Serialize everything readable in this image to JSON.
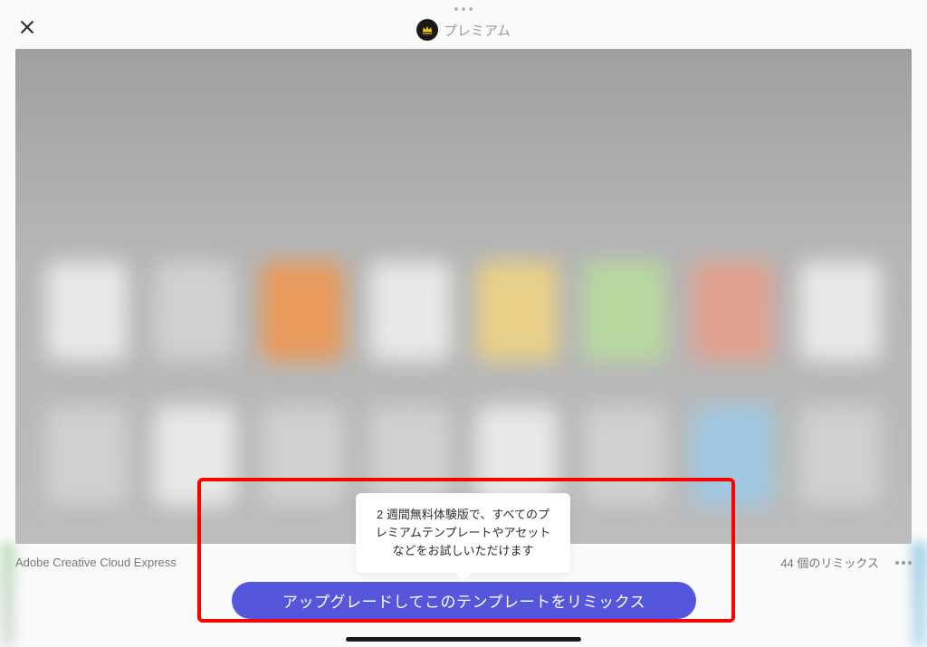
{
  "header": {
    "premium_label": "プレミアム"
  },
  "tooltip": {
    "text": "2 週間無料体験版で、すべてのプレミアムテンプレートやアセットなどをお試しいただけます"
  },
  "upgrade_button": {
    "label": "アップグレードしてこのテンプレートをリミックス"
  },
  "footer": {
    "app_name": "Adobe Creative Cloud Express",
    "remix_count": "44 個のリミックス"
  },
  "icons": {
    "close": "close-icon",
    "crown": "crown-icon",
    "more": "more-icon"
  }
}
